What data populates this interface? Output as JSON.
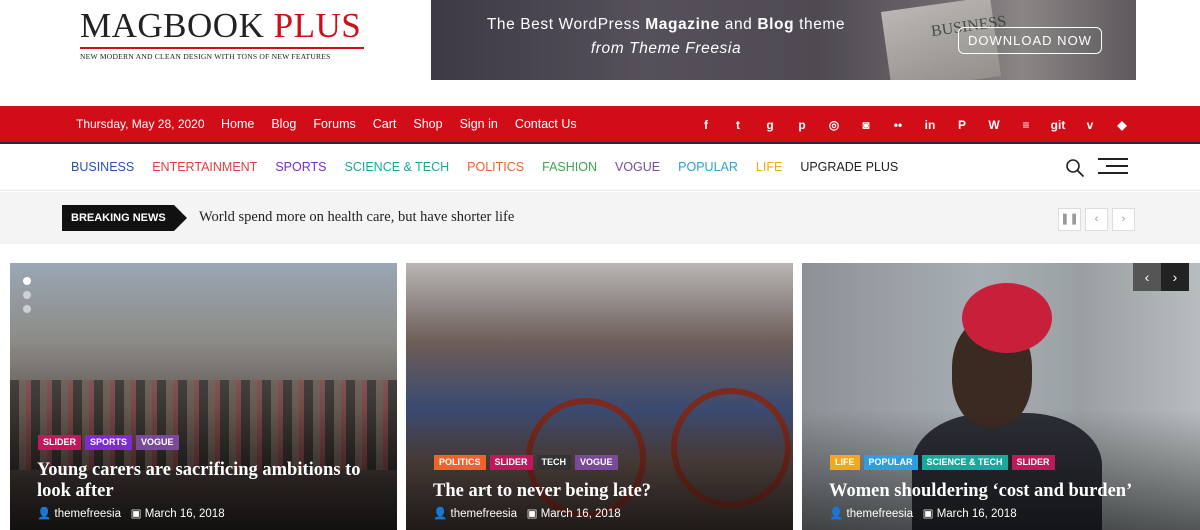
{
  "header": {
    "logo_main": "MAGBOOK",
    "logo_accent": "PLUS",
    "tagline": "NEW MODERN AND CLEAN DESIGN WITH TONS OF NEW FEATURES",
    "banner": {
      "line1_a": "The Best WordPress ",
      "line1_b": "Magazine",
      "line1_c": " and ",
      "line1_d": "Blog",
      "line1_e": " theme",
      "line2": "from Theme Freesia",
      "paper_text": "BUSINESS",
      "button": "DOWNLOAD NOW"
    }
  },
  "topbar": {
    "date": "Thursday, May 28, 2020",
    "nav": [
      "Home",
      "Blog",
      "Forums",
      "Cart",
      "Shop",
      "Sign in",
      "Contact Us"
    ],
    "social": [
      {
        "icon": "facebook-icon",
        "glyph": "f"
      },
      {
        "icon": "twitter-icon",
        "glyph": "t"
      },
      {
        "icon": "google-plus-icon",
        "glyph": "g"
      },
      {
        "icon": "pinterest-icon",
        "glyph": "p"
      },
      {
        "icon": "dribbble-icon",
        "glyph": "◎"
      },
      {
        "icon": "instagram-icon",
        "glyph": "◙"
      },
      {
        "icon": "flickr-icon",
        "glyph": "••"
      },
      {
        "icon": "linkedin-icon",
        "glyph": "in"
      },
      {
        "icon": "paypal-icon",
        "glyph": "P"
      },
      {
        "icon": "wordpress-icon",
        "glyph": "W"
      },
      {
        "icon": "stack-overflow-icon",
        "glyph": "≡"
      },
      {
        "icon": "git-icon",
        "glyph": "git"
      },
      {
        "icon": "vine-icon",
        "glyph": "v"
      },
      {
        "icon": "dropbox-icon",
        "glyph": "◆"
      }
    ]
  },
  "categories": [
    {
      "label": "BUSINESS",
      "color": "#2652b5"
    },
    {
      "label": "ENTERTAINMENT",
      "color": "#e53c3c"
    },
    {
      "label": "SPORTS",
      "color": "#7a2bd1"
    },
    {
      "label": "SCIENCE & TECH",
      "color": "#17a99b"
    },
    {
      "label": "POLITICS",
      "color": "#f0622a"
    },
    {
      "label": "FASHION",
      "color": "#3aa84b"
    },
    {
      "label": "VOGUE",
      "color": "#7a4a9a"
    },
    {
      "label": "POPULAR",
      "color": "#2b9fe0"
    },
    {
      "label": "LIFE",
      "color": "#f5a71b"
    },
    {
      "label": "UPGRADE PLUS",
      "color": "#222222"
    }
  ],
  "breaking": {
    "label": "BREAKING NEWS",
    "headline": "World spend more on health care, but have shorter life"
  },
  "slides": [
    {
      "tags": [
        {
          "label": "SLIDER",
          "color": "#c2185b"
        },
        {
          "label": "SPORTS",
          "color": "#7a2bd1"
        },
        {
          "label": "VOGUE",
          "color": "#7a4a9a"
        }
      ],
      "title": "Young carers are sacrificing ambitions to look after",
      "author": "themefreesia",
      "date": "March 16, 2018"
    },
    {
      "tags": [
        {
          "label": "POLITICS",
          "color": "#f0622a"
        },
        {
          "label": "SLIDER",
          "color": "#c2185b"
        },
        {
          "label": "TECH",
          "color": "#333333"
        },
        {
          "label": "VOGUE",
          "color": "#7a4a9a"
        }
      ],
      "title": "The art to never being late?",
      "author": "themefreesia",
      "date": "March 16, 2018"
    },
    {
      "tags": [
        {
          "label": "LIFE",
          "color": "#f5a71b"
        },
        {
          "label": "POPULAR",
          "color": "#2b9fe0"
        },
        {
          "label": "SCIENCE & TECH",
          "color": "#17a99b"
        },
        {
          "label": "SLIDER",
          "color": "#c2185b"
        }
      ],
      "title": "Women shouldering ‘cost and burden’",
      "author": "themefreesia",
      "date": "March 16, 2018"
    }
  ]
}
